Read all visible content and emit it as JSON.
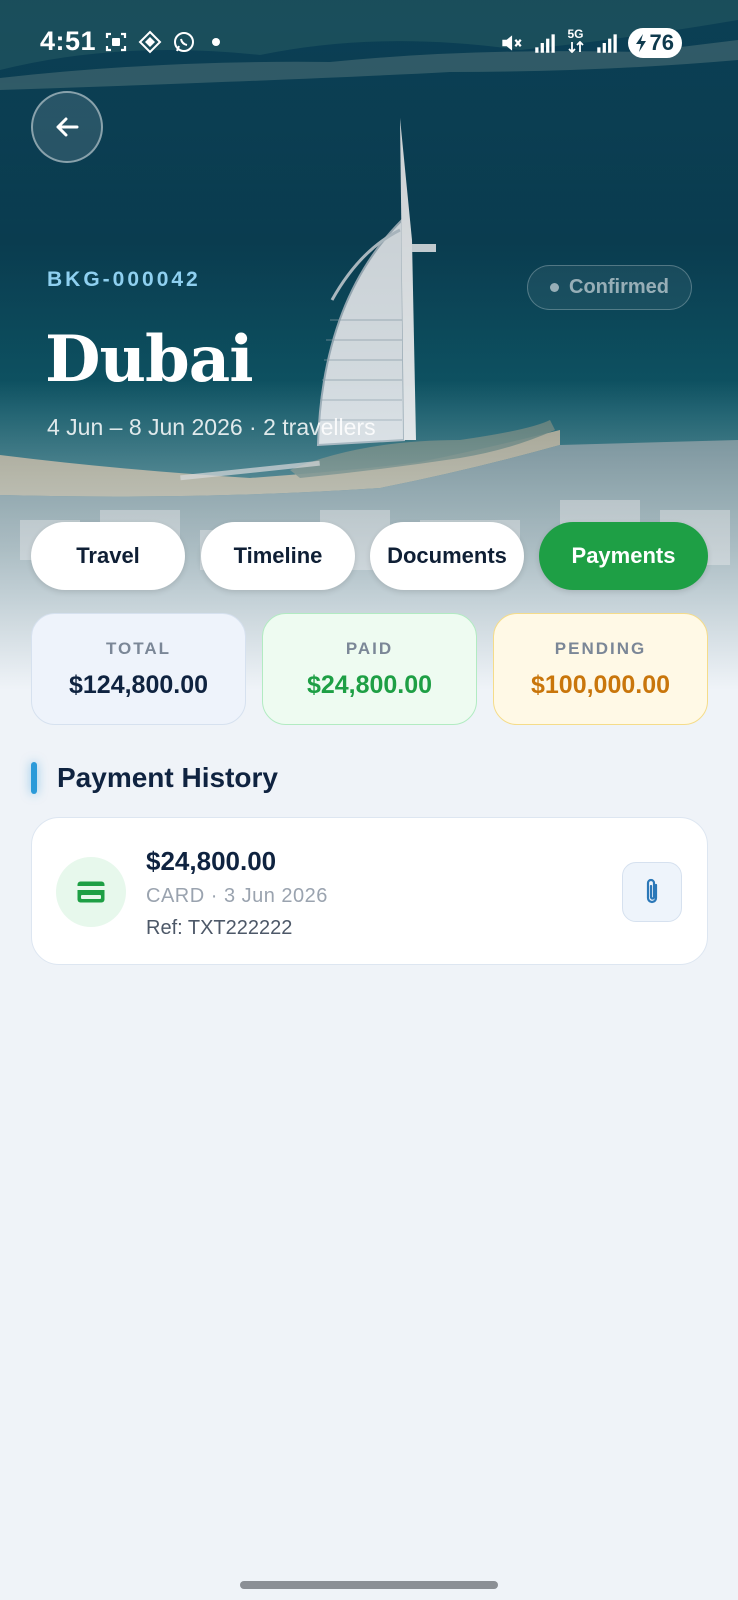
{
  "status_bar": {
    "time": "4:51",
    "network": "5G",
    "battery": "76",
    "icons": [
      "screenshot-icon",
      "app-icon",
      "whatsapp-icon",
      "notification-dot",
      "mute-icon",
      "signal-icon",
      "5g-icon",
      "signal-icon",
      "battery-charging-icon"
    ]
  },
  "hero": {
    "booking_id": "BKG-000042",
    "status": "Confirmed",
    "destination": "Dubai",
    "meta": "4 Jun – 8 Jun 2026 · 2 travellers"
  },
  "tabs": [
    {
      "label": "Travel",
      "active": false
    },
    {
      "label": "Timeline",
      "active": false
    },
    {
      "label": "Documents",
      "active": false
    },
    {
      "label": "Payments",
      "active": true
    }
  ],
  "summary": {
    "total": {
      "label": "TOTAL",
      "amount": "$124,800.00"
    },
    "paid": {
      "label": "PAID",
      "amount": "$24,800.00"
    },
    "pending": {
      "label": "PENDING",
      "amount": "$100,000.00"
    }
  },
  "payment_history": {
    "title": "Payment History",
    "items": [
      {
        "amount": "$24,800.00",
        "method": "CARD · 3 Jun 2026",
        "ref": "Ref: TXT222222",
        "icon": "credit-card-icon"
      }
    ]
  },
  "colors": {
    "accent_green": "#1e9f45",
    "pending_orange": "#c9760b",
    "navy": "#0f2340",
    "section_accent": "#2b9ad9"
  }
}
